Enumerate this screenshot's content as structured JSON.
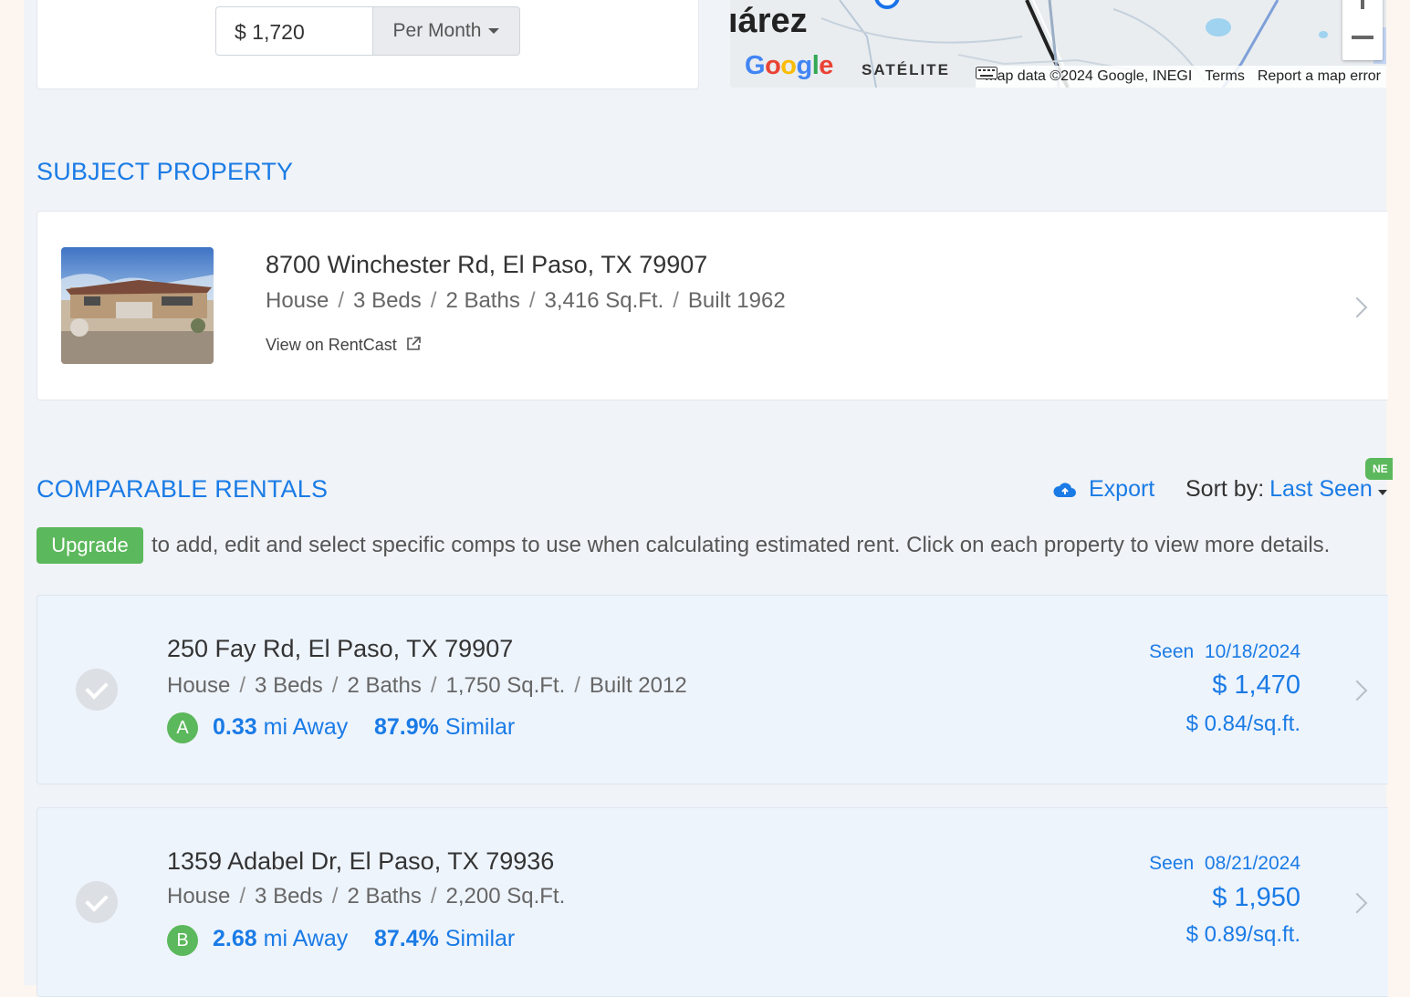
{
  "rent": {
    "value": "$ 1,720",
    "period": "Per Month"
  },
  "map": {
    "city_label": "ıárez",
    "google": [
      "G",
      "o",
      "o",
      "g",
      "l",
      "e"
    ],
    "satellite": "SATÉLITE",
    "attribution": "Map data ©2024 Google, INEGI",
    "terms": "Terms",
    "report": "Report a map error"
  },
  "subject": {
    "section_title": "SUBJECT PROPERTY",
    "address": "8700 Winchester Rd, El Paso, TX 79907",
    "meta": [
      "House",
      "3 Beds",
      "2 Baths",
      "3,416 Sq.Ft.",
      "Built 1962"
    ],
    "link": "View on RentCast"
  },
  "comparables": {
    "section_title": "COMPARABLE RENTALS",
    "export_label": "Export",
    "sort_label": "Sort by:",
    "sort_value": "Last Seen",
    "new_badge": "NE",
    "upgrade_label": "Upgrade",
    "upgrade_text": "to add, edit and select specific comps to use when calculating estimated rent. Click on each property to view more details.",
    "items": [
      {
        "address": "250 Fay Rd, El Paso, TX 79907",
        "meta": [
          "House",
          "3 Beds",
          "2 Baths",
          "1,750 Sq.Ft.",
          "Built 2012"
        ],
        "letter": "A",
        "distance": "0.33",
        "distance_suffix": " mi Away",
        "similarity": "87.9%",
        "similarity_suffix": " Similar",
        "seen_label": "Seen",
        "seen_date": "10/18/2024",
        "price": "$ 1,470",
        "per_sqft": "$ 0.84/sq.ft."
      },
      {
        "address": "1359 Adabel Dr, El Paso, TX 79936",
        "meta": [
          "House",
          "3 Beds",
          "2 Baths",
          "2,200 Sq.Ft."
        ],
        "letter": "B",
        "distance": "2.68",
        "distance_suffix": " mi Away",
        "similarity": "87.4%",
        "similarity_suffix": " Similar",
        "seen_label": "Seen",
        "seen_date": "08/21/2024",
        "price": "$ 1,950",
        "per_sqft": "$ 0.89/sq.ft."
      }
    ]
  },
  "colors": {
    "accent": "#1a7be6",
    "success": "#5cb85c",
    "background": "#f0f3f7"
  },
  "icons": [
    "cloud-upload-icon",
    "external-link-icon",
    "chevron-right-icon",
    "check-circle-icon",
    "keyboard-icon",
    "caret-down-icon"
  ]
}
